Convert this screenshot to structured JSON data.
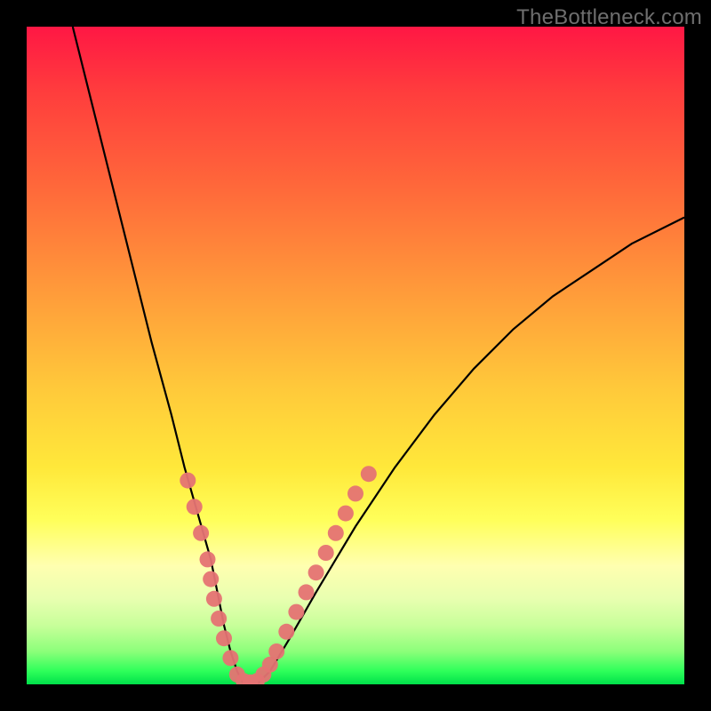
{
  "watermark": "TheBottleneck.com",
  "chart_data": {
    "type": "line",
    "title": "",
    "xlabel": "",
    "ylabel": "",
    "xlim": [
      0,
      100
    ],
    "ylim": [
      0,
      100
    ],
    "grid": false,
    "legend": false,
    "series": [
      {
        "name": "bottleneck-curve",
        "color": "#000000",
        "x": [
          7,
          10,
          13,
          16,
          19,
          22,
          24,
          26,
          28,
          29,
          30,
          31,
          32,
          33,
          35,
          37,
          40,
          44,
          50,
          56,
          62,
          68,
          74,
          80,
          86,
          92,
          98,
          100
        ],
        "y": [
          100,
          88,
          76,
          64,
          52,
          41,
          33,
          26,
          19,
          14,
          9,
          5,
          2,
          0,
          0,
          2,
          7,
          14,
          24,
          33,
          41,
          48,
          54,
          59,
          63,
          67,
          70,
          71
        ]
      }
    ],
    "markers": {
      "name": "highlighted-points",
      "color": "#e57373",
      "points": [
        {
          "x": 24.5,
          "y": 31
        },
        {
          "x": 25.5,
          "y": 27
        },
        {
          "x": 26.5,
          "y": 23
        },
        {
          "x": 27.5,
          "y": 19
        },
        {
          "x": 28.0,
          "y": 16
        },
        {
          "x": 28.5,
          "y": 13
        },
        {
          "x": 29.2,
          "y": 10
        },
        {
          "x": 30.0,
          "y": 7
        },
        {
          "x": 31.0,
          "y": 4
        },
        {
          "x": 32.0,
          "y": 1.5
        },
        {
          "x": 33.0,
          "y": 0.5
        },
        {
          "x": 34.0,
          "y": 0.3
        },
        {
          "x": 35.0,
          "y": 0.5
        },
        {
          "x": 36.0,
          "y": 1.5
        },
        {
          "x": 37.0,
          "y": 3
        },
        {
          "x": 38.0,
          "y": 5
        },
        {
          "x": 39.5,
          "y": 8
        },
        {
          "x": 41.0,
          "y": 11
        },
        {
          "x": 42.5,
          "y": 14
        },
        {
          "x": 44.0,
          "y": 17
        },
        {
          "x": 45.5,
          "y": 20
        },
        {
          "x": 47.0,
          "y": 23
        },
        {
          "x": 48.5,
          "y": 26
        },
        {
          "x": 50.0,
          "y": 29
        },
        {
          "x": 52.0,
          "y": 32
        }
      ]
    },
    "gradient_stops": [
      {
        "pos": 0,
        "color": "#ff1744"
      },
      {
        "pos": 0.1,
        "color": "#ff3d3d"
      },
      {
        "pos": 0.25,
        "color": "#ff6a3a"
      },
      {
        "pos": 0.4,
        "color": "#ff9a3a"
      },
      {
        "pos": 0.55,
        "color": "#ffc93a"
      },
      {
        "pos": 0.67,
        "color": "#ffe83a"
      },
      {
        "pos": 0.75,
        "color": "#ffff5a"
      },
      {
        "pos": 0.82,
        "color": "#ffffb0"
      },
      {
        "pos": 0.87,
        "color": "#e8ffb0"
      },
      {
        "pos": 0.91,
        "color": "#c8ff9a"
      },
      {
        "pos": 0.95,
        "color": "#8cff7a"
      },
      {
        "pos": 0.98,
        "color": "#2eff5a"
      },
      {
        "pos": 1.0,
        "color": "#00e04a"
      }
    ]
  }
}
